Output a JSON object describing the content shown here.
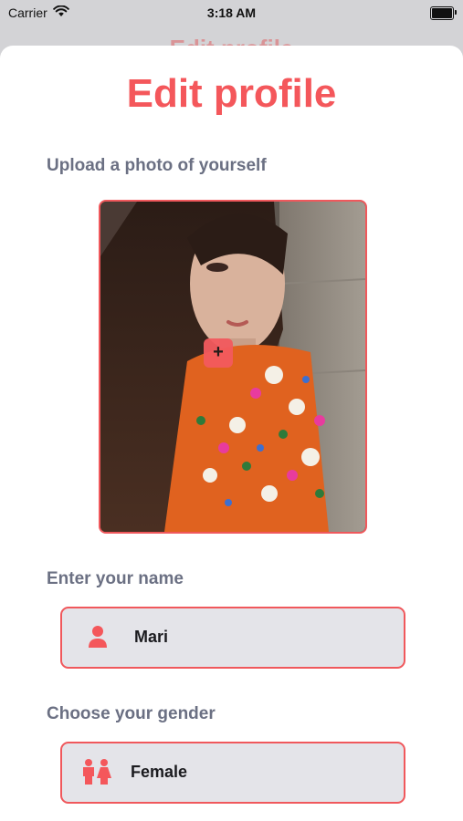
{
  "status_bar": {
    "carrier": "Carrier",
    "time": "3:18 AM",
    "icons": [
      "wifi-icon",
      "battery-icon"
    ]
  },
  "page": {
    "title": "Edit profile",
    "accent_color": "#f4575b"
  },
  "photo_section": {
    "label": "Upload a photo of yourself",
    "add_icon": "plus-icon",
    "add_glyph": "+"
  },
  "name_section": {
    "label": "Enter your name",
    "icon": "person-icon",
    "value": "Mari"
  },
  "gender_section": {
    "label": "Choose your gender",
    "icon": "gender-icon",
    "value": "Female"
  }
}
